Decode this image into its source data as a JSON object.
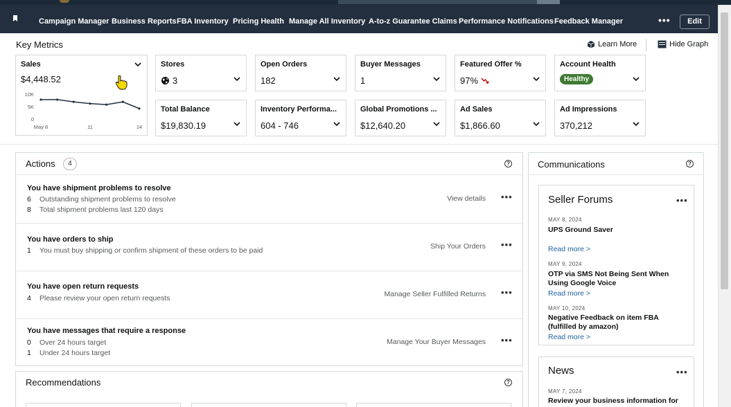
{
  "nav": {
    "items": [
      "Campaign Manager",
      "Business Reports",
      "FBA Inventory",
      "Pricing Health",
      "Manage All Inventory",
      "A-to-z Guarantee Claims",
      "Performance Notifications",
      "Feedback Manager"
    ],
    "more_label": "•••",
    "edit_label": "Edit"
  },
  "key_metrics": {
    "title": "Key Metrics",
    "learn_more": "Learn More",
    "hide_graph": "Hide Graph",
    "sales": {
      "label": "Sales",
      "value": "$4,448.52"
    },
    "cards": [
      {
        "label": "Stores",
        "value": "3",
        "icon": "globe-icon"
      },
      {
        "label": "Open Orders",
        "value": "182"
      },
      {
        "label": "Buyer Messages",
        "value": "1"
      },
      {
        "label": "Featured Offer %",
        "value": "97%",
        "icon": "trend-down-icon"
      },
      {
        "label": "Account Health",
        "value": "Healthy",
        "status_color": "#3d7a31"
      },
      {
        "label": "Total Balance",
        "value": "$19,830.19"
      },
      {
        "label": "Inventory Performa...",
        "value": "604 - 746"
      },
      {
        "label": "Global Promotions ...",
        "value": "$12,640.20"
      },
      {
        "label": "Ad Sales",
        "value": "$1,866.60"
      },
      {
        "label": "Ad Impressions",
        "value": "370,212"
      }
    ]
  },
  "chart_data": {
    "type": "line",
    "y_ticks": [
      "10K",
      "5K",
      "0"
    ],
    "x_ticks": [
      "May 8",
      "11",
      "14"
    ],
    "ylim": [
      0,
      10000
    ],
    "x": [
      8,
      9,
      10,
      11,
      12,
      13,
      14
    ],
    "values": [
      7800,
      7800,
      6900,
      6200,
      5800,
      6900,
      4200
    ],
    "color": "#232f3e"
  },
  "actions": {
    "title": "Actions",
    "count": "4",
    "help": "?",
    "rows": [
      {
        "title": "You have shipment problems to resolve",
        "lines": [
          {
            "num": "6",
            "text": "Outstanding shipment problems to resolve"
          },
          {
            "num": "8",
            "text": "Total shipment problems last 120 days"
          }
        ],
        "link": "View details"
      },
      {
        "title": "You have orders to ship",
        "lines": [
          {
            "num": "1",
            "text": "You must buy shipping or confirm shipment of these orders to be paid"
          }
        ],
        "link": "Ship Your Orders"
      },
      {
        "title": "You have open return requests",
        "lines": [
          {
            "num": "4",
            "text": "Please review your open return requests"
          }
        ],
        "link": "Manage Seller Fulfilled Returns"
      },
      {
        "title": "You have messages that require a response",
        "lines": [
          {
            "num": "0",
            "text": "Over 24 hours target"
          },
          {
            "num": "1",
            "text": "Under 24 hours target"
          }
        ],
        "link": "Manage Your Buyer Messages"
      }
    ]
  },
  "recommendations": {
    "title": "Recommendations",
    "help": "?"
  },
  "communications": {
    "title": "Communications",
    "help": "?",
    "forums": {
      "title": "Seller Forums",
      "posts": [
        {
          "date": "MAY 8, 2024",
          "title": "UPS Ground Saver",
          "read_more": "Read more >"
        },
        {
          "date": "MAY 9, 2024",
          "title": "OTP via SMS Not Being Sent When Using Google Voice",
          "read_more": "Read more >"
        },
        {
          "date": "MAY 10, 2024",
          "title": "Negative Feedback on item FBA (fulfilled by amazon)",
          "read_more": "Read more >"
        }
      ]
    },
    "news": {
      "title": "News",
      "posts": [
        {
          "date": "MAY 7, 2024",
          "title": "Review your business information for"
        }
      ]
    }
  },
  "colors": {
    "nav_bg": "#232f3e",
    "link": "#2162a1",
    "healthy": "#3d7a31",
    "trend_down": "#c40000"
  }
}
